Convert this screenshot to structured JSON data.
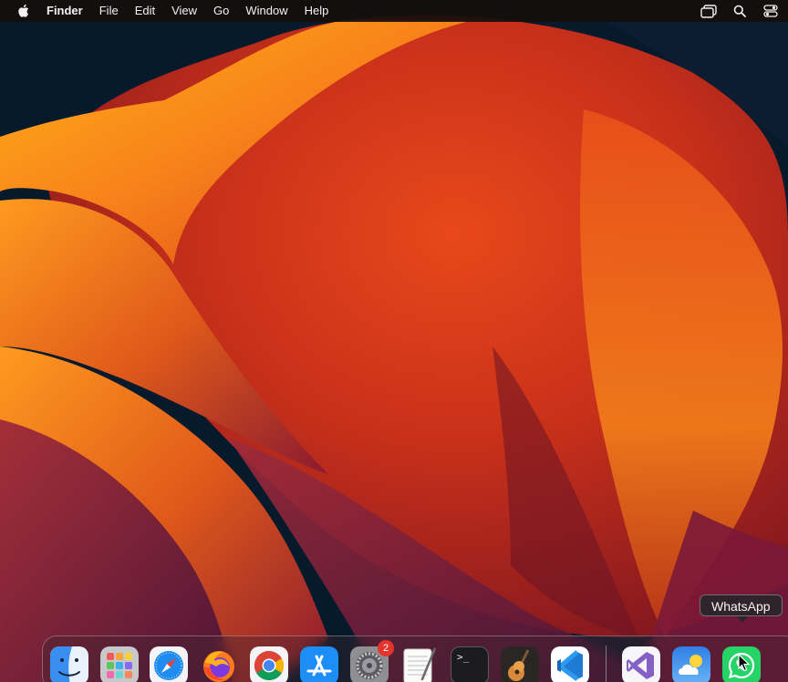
{
  "menubar": {
    "app_name": "Finder",
    "items": [
      "File",
      "Edit",
      "View",
      "Go",
      "Window",
      "Help"
    ],
    "status_icons": [
      "screen-mirroring-icon",
      "search-icon",
      "control-center-icon"
    ]
  },
  "tooltip": {
    "text": "WhatsApp"
  },
  "dock": {
    "apps": [
      {
        "name": "Finder",
        "icon": "finder-icon"
      },
      {
        "name": "Launchpad",
        "icon": "launchpad-icon"
      },
      {
        "name": "Safari",
        "icon": "safari-icon"
      },
      {
        "name": "Firefox",
        "icon": "firefox-icon"
      },
      {
        "name": "Google Chrome",
        "icon": "chrome-icon"
      },
      {
        "name": "App Store",
        "icon": "app-store-icon"
      },
      {
        "name": "System Settings",
        "icon": "system-settings-icon",
        "badge": "2"
      },
      {
        "name": "TextEdit",
        "icon": "textedit-icon"
      },
      {
        "name": "Terminal",
        "icon": "terminal-icon"
      },
      {
        "name": "GarageBand",
        "icon": "garageband-icon"
      },
      {
        "name": "Visual Studio Code",
        "icon": "vscode-icon"
      },
      {
        "name": "Visual Studio",
        "icon": "visual-studio-icon"
      },
      {
        "name": "Weather",
        "icon": "weather-icon"
      },
      {
        "name": "WhatsApp",
        "icon": "whatsapp-icon"
      }
    ],
    "terminal_prompt": ">_"
  },
  "colors": {
    "menubar_bg": "#140e0c",
    "badge": "#e5342b",
    "whatsapp_green": "#25d366"
  }
}
